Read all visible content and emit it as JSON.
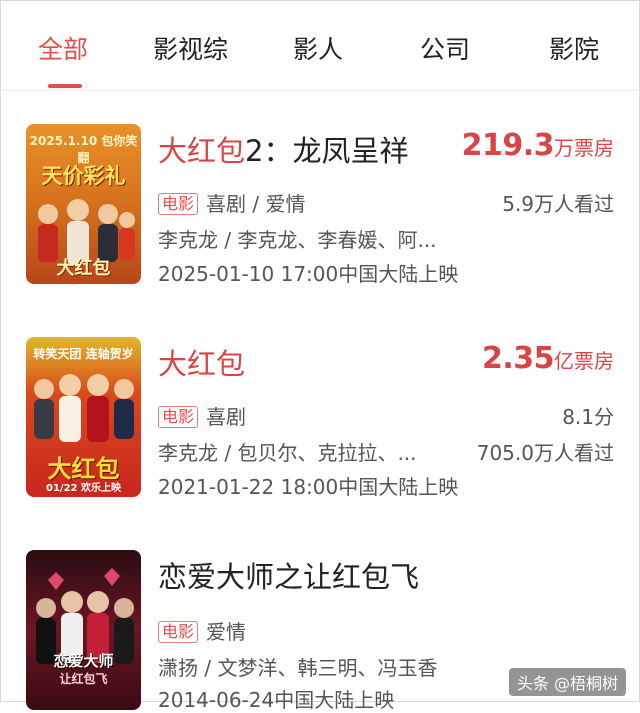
{
  "tabs": [
    "全部",
    "影视综",
    "影人",
    "公司",
    "影院"
  ],
  "active_tab": 0,
  "accent_color": "#e54b4b",
  "results": [
    {
      "title_highlight": "大红包",
      "title_rest": "2：龙凤呈祥",
      "box_value": "219.3",
      "box_unit": "万票房",
      "badge": "电影",
      "genre": "喜剧 / 爱情",
      "viewers": "5.9万人看过",
      "cast": "李克龙 / 李克龙、李春媛、阿...",
      "release": "2025-01-10 17:00中国大陆上映",
      "poster_top": "2025.1.10  包你笑翻",
      "poster_title": "天价彩礼",
      "poster_sub": "大红包",
      "poster_color": "#d8741e"
    },
    {
      "title_highlight": "大红包",
      "title_rest": "",
      "box_value": "2.35",
      "box_unit": "亿票房",
      "badge": "电影",
      "genre": "喜剧",
      "score": "8.1分",
      "viewers": "705.0万人看过",
      "cast": "李克龙 / 包贝尔、克拉拉、...",
      "release": "2021-01-22 18:00中国大陆上映",
      "poster_top": "转笑天团  连轴贺岁",
      "poster_title": "大红包",
      "poster_sub": "01/22 欢乐上映",
      "poster_color": "#c9261f"
    },
    {
      "title_highlight": "",
      "title_rest": "恋爱大师之让红包飞",
      "badge": "电影",
      "genre": "爱情",
      "cast": "潇扬 / 文梦洋、韩三明、冯玉香",
      "release": "2014-06-24中国大陆上映",
      "poster_top": "",
      "poster_title": "恋爱大师",
      "poster_sub": "让红包飞",
      "poster_color": "#6d1624"
    }
  ],
  "watermark": "头条 @梧桐树"
}
